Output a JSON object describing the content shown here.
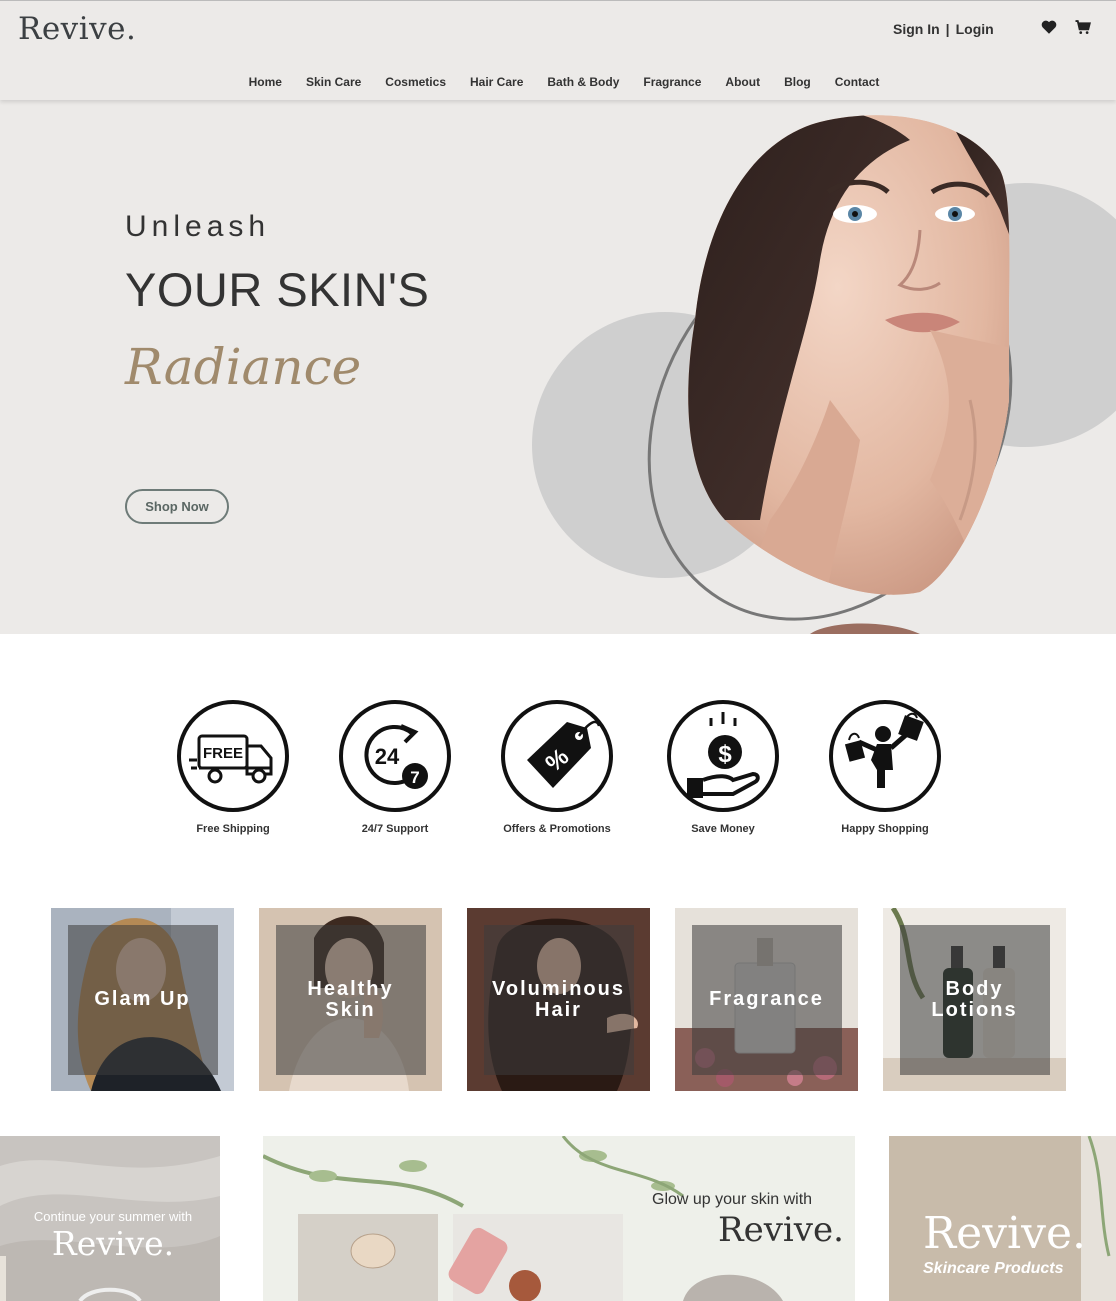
{
  "header": {
    "logo": "Revive.",
    "sign_in": "Sign In",
    "separator": "|",
    "login": "Login",
    "icons": [
      "heart-icon",
      "cart-icon"
    ]
  },
  "nav": [
    "Home",
    "Skin Care",
    "Cosmetics",
    "Hair Care",
    "Bath & Body",
    "Fragrance",
    "About",
    "Blog",
    "Contact"
  ],
  "hero": {
    "line1": "Unleash",
    "line2": "YOUR SKIN'S",
    "line3": "Radiance",
    "button": "Shop Now"
  },
  "features": [
    {
      "label": "Free Shipping",
      "icon": "free-shipping-truck-icon"
    },
    {
      "label": "24/7 Support",
      "icon": "support-24-7-icon"
    },
    {
      "label": "Offers & Promotions",
      "icon": "price-tag-percent-icon"
    },
    {
      "label": "Save Money",
      "icon": "hand-coin-icon"
    },
    {
      "label": "Happy Shopping",
      "icon": "shopper-bags-icon"
    }
  ],
  "free_badge": "FREE",
  "support_num": "24",
  "support_seven": "7",
  "percent_sign": "%",
  "dollar_sign": "$",
  "categories": [
    {
      "line1": "Glam Up",
      "line2": ""
    },
    {
      "line1": "Healthy",
      "line2": "Skin"
    },
    {
      "line1": "Voluminous",
      "line2": "Hair"
    },
    {
      "line1": "Fragrance",
      "line2": ""
    },
    {
      "line1": "Body",
      "line2": "Lotions"
    }
  ],
  "promos": {
    "p1_line": "Continue your summer with",
    "p1_brand": "Revive.",
    "p2_line": "Glow up your skin with",
    "p2_brand": "Revive.",
    "p3_brand": "Revive.",
    "p3_sub": "Skincare Products"
  },
  "colors": {
    "header_bg": "#eceae8",
    "hero_bg": "#eceae8",
    "accent_gold": "#a08a6c",
    "button_border": "#6e7b78"
  }
}
